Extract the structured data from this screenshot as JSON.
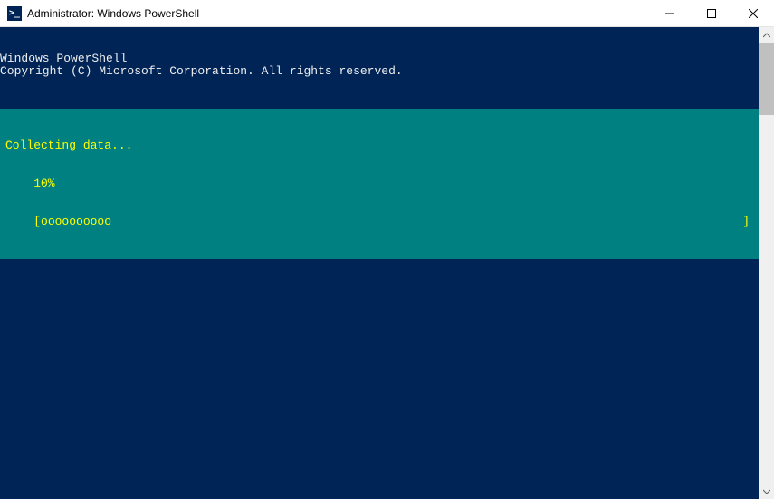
{
  "titlebar": {
    "icon_glyph": ">_",
    "title": "Administrator: Windows PowerShell"
  },
  "terminal": {
    "header_line1": "Windows PowerShell",
    "header_line2": "Copyright (C) Microsoft Corporation. All rights reserved.",
    "progress": {
      "status": "Collecting data...",
      "percent": "    10%",
      "bar_open": "    [",
      "bar_fill": "oooooooooo",
      "bar_close": "]"
    }
  },
  "colors": {
    "terminal_bg": "#012456",
    "progress_bg": "#008080",
    "progress_fg": "#ffff00"
  }
}
